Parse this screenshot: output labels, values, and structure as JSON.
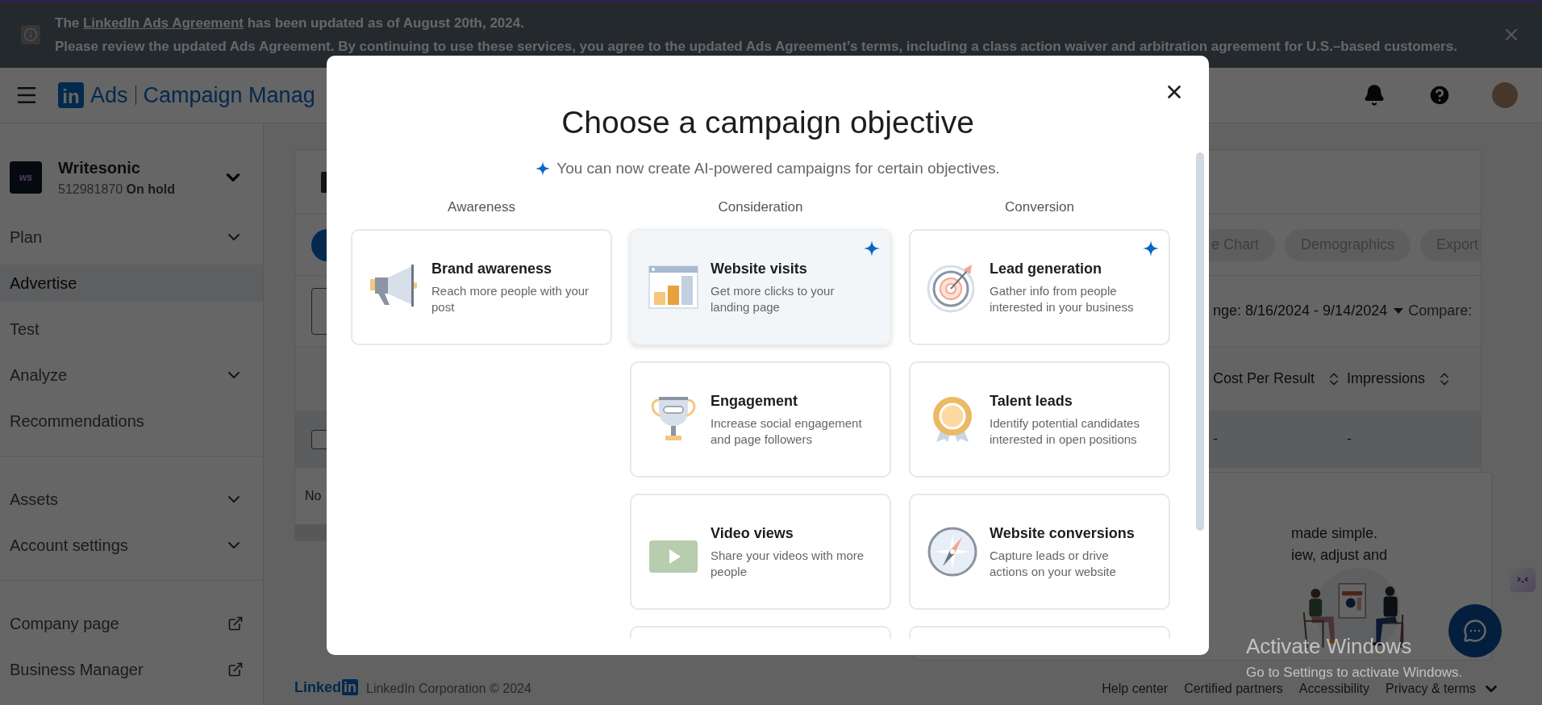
{
  "banner": {
    "prefix": "The",
    "link": "LinkedIn Ads Agreement",
    "suffix": "has been updated as of August 20th, 2024.",
    "line2": "Please review the updated Ads Agreement. By continuing to use these services, you agree to the updated Ads Agreement’s terms, including a class action waiver and arbitration agreement for U.S.–based customers."
  },
  "header": {
    "logo": "in",
    "product": "Ads",
    "title": "Campaign Manag"
  },
  "sidebar": {
    "account": {
      "name": "Writesonic",
      "logo": "ws",
      "id": "512981870",
      "status": "On hold"
    },
    "sections": [
      {
        "items": [
          {
            "label": "Plan",
            "kind": "expandable",
            "selected": false
          },
          {
            "label": "Advertise",
            "kind": "plain",
            "selected": true
          },
          {
            "label": "Test",
            "kind": "plain",
            "selected": false
          },
          {
            "label": "Analyze",
            "kind": "expandable",
            "selected": false
          },
          {
            "label": "Recommendations",
            "kind": "plain",
            "selected": false
          }
        ]
      },
      {
        "items": [
          {
            "label": "Assets",
            "kind": "expandable",
            "selected": false
          },
          {
            "label": "Account settings",
            "kind": "expandable",
            "selected": false
          }
        ]
      },
      {
        "items": [
          {
            "label": "Company page",
            "kind": "external",
            "selected": false
          },
          {
            "label": "Business Manager",
            "kind": "external",
            "selected": false
          }
        ]
      }
    ]
  },
  "main": {
    "toolbar_buttons": [
      "e Chart",
      "Demographics",
      "Export"
    ],
    "date_range": "nge: 8/16/2024 - 9/14/2024",
    "compare_label": "Compare:",
    "columns": [
      "Cost Per Result",
      "Impressions"
    ],
    "rows": [
      {
        "cells": [
          "-",
          "-"
        ],
        "selected": true
      }
    ],
    "empty_text": "No",
    "promo": {
      "lines": [
        "made simple.",
        "iew, adjust and"
      ]
    }
  },
  "footer": {
    "logo_word": "Linked",
    "logo_mark": "in",
    "copyright": "LinkedIn Corporation © 2024",
    "links": [
      "Help center",
      "Certified partners",
      "Accessibility",
      "Privacy & terms"
    ]
  },
  "modal": {
    "title": "Choose a campaign objective",
    "subtitle": "You can now create AI-powered campaigns for certain objectives.",
    "columns": [
      {
        "heading": "Awareness",
        "more_below": false,
        "cards": [
          {
            "title": "Brand awareness",
            "description": "Reach more people with your post",
            "kind": "megaphone",
            "ai": false,
            "selected": false
          }
        ]
      },
      {
        "heading": "Consideration",
        "more_below": true,
        "cards": [
          {
            "title": "Website visits",
            "description": "Get more clicks to your landing page",
            "kind": "chart",
            "ai": true,
            "selected": true
          },
          {
            "title": "Engagement",
            "description": "Increase social engagement and page followers",
            "kind": "trophy",
            "ai": false,
            "selected": false
          },
          {
            "title": "Video views",
            "description": "Share your videos with more people",
            "kind": "video",
            "ai": false,
            "selected": false
          }
        ]
      },
      {
        "heading": "Conversion",
        "more_below": true,
        "cards": [
          {
            "title": "Lead generation",
            "description": "Gather info from people interested in your business",
            "kind": "target",
            "ai": true,
            "selected": false
          },
          {
            "title": "Talent leads",
            "description": "Identify potential candidates interested in open positions",
            "kind": "ribbon",
            "ai": false,
            "selected": false
          },
          {
            "title": "Website conversions",
            "description": "Capture leads or drive actions on your website",
            "kind": "compass",
            "ai": false,
            "selected": false
          }
        ]
      }
    ]
  },
  "os_notice": {
    "title": "Activate Windows",
    "subtitle": "Go to Settings to activate Windows."
  }
}
